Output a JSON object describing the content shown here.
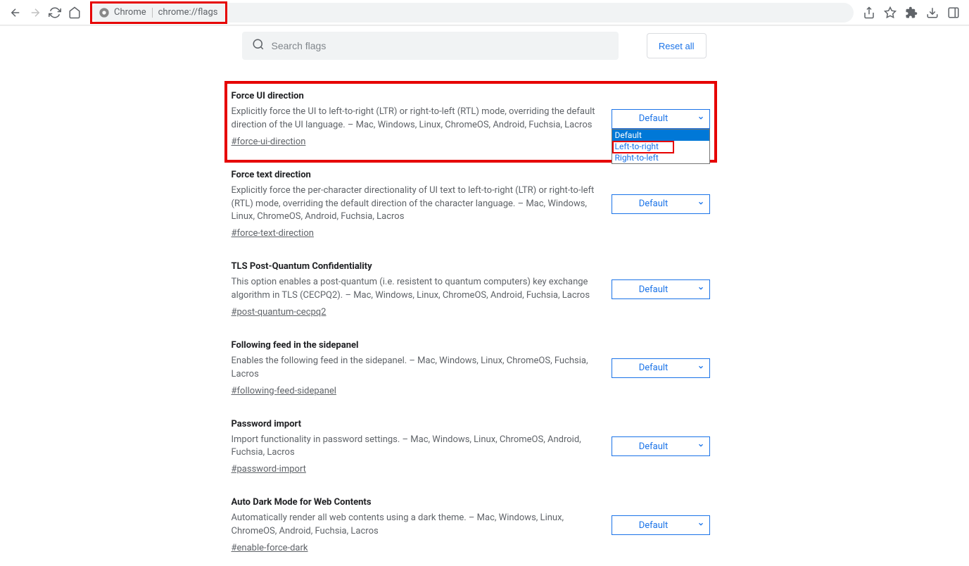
{
  "addressbar": {
    "label": "Chrome",
    "url": "chrome://flags"
  },
  "search": {
    "placeholder": "Search flags"
  },
  "reset_label": "Reset all",
  "dropdown": {
    "default": "Default",
    "ltr": "Left-to-right",
    "rtl": "Right-to-left"
  },
  "flags": [
    {
      "title": "Force UI direction",
      "desc": "Explicitly force the UI to left-to-right (LTR) or right-to-left (RTL) mode, overriding the default direction of the UI language. – Mac, Windows, Linux, ChromeOS, Android, Fuchsia, Lacros",
      "anchor": "#force-ui-direction",
      "value": "Default"
    },
    {
      "title": "Force text direction",
      "desc": "Explicitly force the per-character directionality of UI text to left-to-right (LTR) or right-to-left (RTL) mode, overriding the default direction of the character language. – Mac, Windows, Linux, ChromeOS, Android, Fuchsia, Lacros",
      "anchor": "#force-text-direction",
      "value": "Default"
    },
    {
      "title": "TLS Post-Quantum Confidentiality",
      "desc": "This option enables a post-quantum (i.e. resistent to quantum computers) key exchange algorithm in TLS (CECPQ2). – Mac, Windows, Linux, ChromeOS, Android, Fuchsia, Lacros",
      "anchor": "#post-quantum-cecpq2",
      "value": "Default"
    },
    {
      "title": "Following feed in the sidepanel",
      "desc": "Enables the following feed in the sidepanel. – Mac, Windows, Linux, ChromeOS, Fuchsia, Lacros",
      "anchor": "#following-feed-sidepanel",
      "value": "Default"
    },
    {
      "title": "Password import",
      "desc": "Import functionality in password settings. – Mac, Windows, Linux, ChromeOS, Android, Fuchsia, Lacros",
      "anchor": "#password-import",
      "value": "Default"
    },
    {
      "title": "Auto Dark Mode for Web Contents",
      "desc": "Automatically render all web contents using a dark theme. – Mac, Windows, Linux, ChromeOS, Android, Fuchsia, Lacros",
      "anchor": "#enable-force-dark",
      "value": "Default"
    }
  ]
}
